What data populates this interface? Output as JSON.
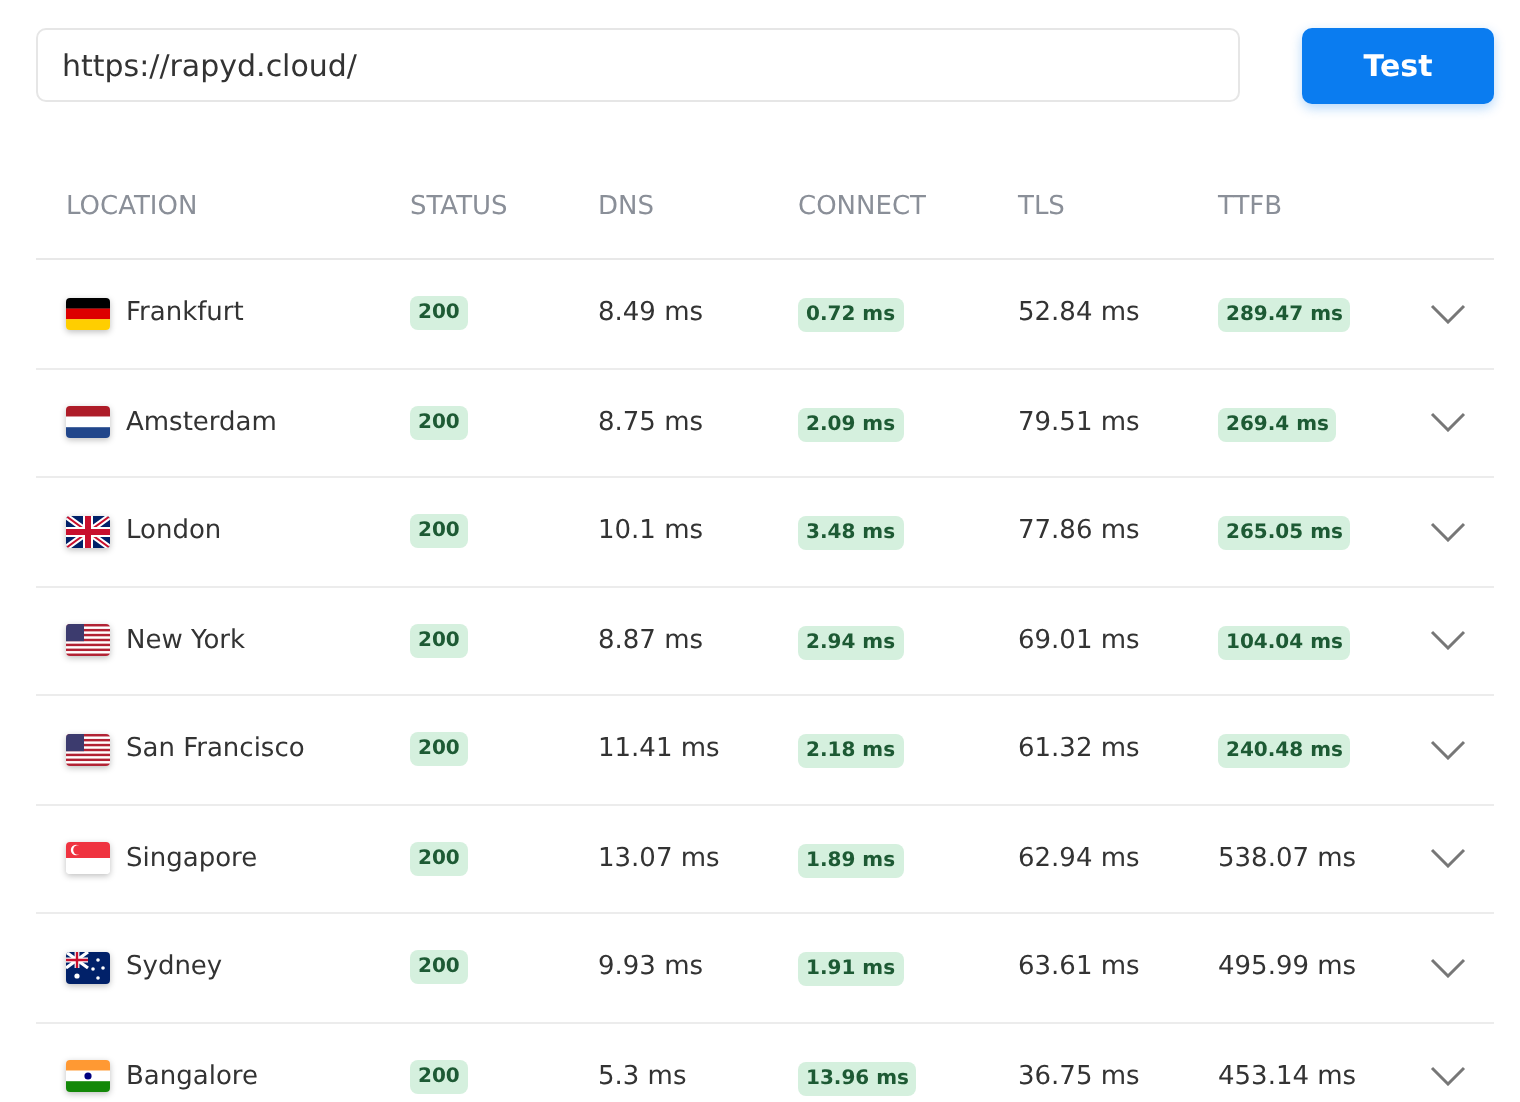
{
  "url_field": {
    "value": "https://rapyd.cloud/"
  },
  "test_button": {
    "label": "Test"
  },
  "table": {
    "columns": [
      "LOCATION",
      "STATUS",
      "DNS",
      "CONNECT",
      "TLS",
      "TTFB"
    ],
    "rows": [
      {
        "kind": "de",
        "location": "Frankfurt",
        "status": "200",
        "dns": {
          "text": "8.49 ms",
          "fast": false
        },
        "connect": {
          "text": "0.72 ms",
          "fast": true
        },
        "tls": {
          "text": "52.84 ms",
          "fast": false
        },
        "ttfb": {
          "text": "289.47 ms",
          "fast": true
        },
        "expanded": false
      },
      {
        "kind": "nl",
        "location": "Amsterdam",
        "status": "200",
        "dns": {
          "text": "8.75 ms",
          "fast": false
        },
        "connect": {
          "text": "2.09 ms",
          "fast": true
        },
        "tls": {
          "text": "79.51 ms",
          "fast": false
        },
        "ttfb": {
          "text": "269.4 ms",
          "fast": true
        },
        "expanded": false
      },
      {
        "kind": "gb",
        "location": "London",
        "status": "200",
        "dns": {
          "text": "10.1 ms",
          "fast": false
        },
        "connect": {
          "text": "3.48 ms",
          "fast": true
        },
        "tls": {
          "text": "77.86 ms",
          "fast": false
        },
        "ttfb": {
          "text": "265.05 ms",
          "fast": true
        },
        "expanded": false
      },
      {
        "kind": "us",
        "location": "New York",
        "status": "200",
        "dns": {
          "text": "8.87 ms",
          "fast": false
        },
        "connect": {
          "text": "2.94 ms",
          "fast": true
        },
        "tls": {
          "text": "69.01 ms",
          "fast": false
        },
        "ttfb": {
          "text": "104.04 ms",
          "fast": true
        },
        "expanded": false
      },
      {
        "kind": "us",
        "location": "San Francisco",
        "status": "200",
        "dns": {
          "text": "11.41 ms",
          "fast": false
        },
        "connect": {
          "text": "2.18 ms",
          "fast": true
        },
        "tls": {
          "text": "61.32 ms",
          "fast": false
        },
        "ttfb": {
          "text": "240.48 ms",
          "fast": true
        },
        "expanded": false
      },
      {
        "kind": "sg",
        "location": "Singapore",
        "status": "200",
        "dns": {
          "text": "13.07 ms",
          "fast": false
        },
        "connect": {
          "text": "1.89 ms",
          "fast": true
        },
        "tls": {
          "text": "62.94 ms",
          "fast": false
        },
        "ttfb": {
          "text": "538.07 ms",
          "fast": false
        },
        "expanded": false
      },
      {
        "kind": "au",
        "location": "Sydney",
        "status": "200",
        "dns": {
          "text": "9.93 ms",
          "fast": false
        },
        "connect": {
          "text": "1.91 ms",
          "fast": true
        },
        "tls": {
          "text": "63.61 ms",
          "fast": false
        },
        "ttfb": {
          "text": "495.99 ms",
          "fast": false
        },
        "expanded": false
      },
      {
        "kind": "in",
        "location": "Bangalore",
        "status": "200",
        "dns": {
          "text": "5.3 ms",
          "fast": false
        },
        "connect": {
          "text": "13.96 ms",
          "fast": true
        },
        "tls": {
          "text": "36.75 ms",
          "fast": false
        },
        "ttfb": {
          "text": "453.14 ms",
          "fast": false
        },
        "expanded": false
      }
    ]
  }
}
